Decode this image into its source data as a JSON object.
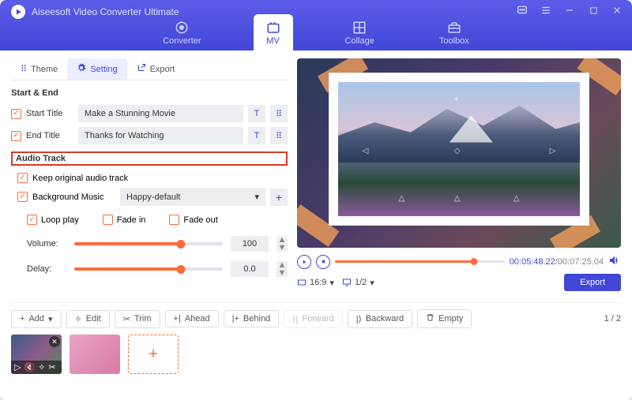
{
  "app": {
    "title": "Aiseesoft Video Converter Ultimate"
  },
  "mainTabs": {
    "converter": "Converter",
    "mv": "MV",
    "collage": "Collage",
    "toolbox": "Toolbox"
  },
  "subTabs": {
    "theme": "Theme",
    "setting": "Setting",
    "export": "Export"
  },
  "sections": {
    "startEnd": "Start & End",
    "audioTrack": "Audio Track"
  },
  "fields": {
    "startTitle": {
      "label": "Start Title",
      "value": "Make a Stunning Movie"
    },
    "endTitle": {
      "label": "End Title",
      "value": "Thanks for Watching"
    },
    "keepOriginal": "Keep original audio track",
    "bgMusic": {
      "label": "Background Music",
      "value": "Happy-default"
    },
    "loop": "Loop play",
    "fadeIn": "Fade in",
    "fadeOut": "Fade out",
    "volume": {
      "label": "Volume:",
      "value": "100",
      "pct": 72
    },
    "delay": {
      "label": "Delay:",
      "value": "0.0",
      "pct": 72
    }
  },
  "playback": {
    "current": "00:05:48.22",
    "duration": "00:07:25.04",
    "aspect": "16:9",
    "page": "1/2"
  },
  "export": "Export",
  "toolbar": {
    "add": "Add",
    "edit": "Edit",
    "trim": "Trim",
    "ahead": "Ahead",
    "behind": "Behind",
    "forward": "Forward",
    "backward": "Backward",
    "empty": "Empty"
  },
  "pager": {
    "current": "1",
    "sep": " / ",
    "total": "2"
  }
}
